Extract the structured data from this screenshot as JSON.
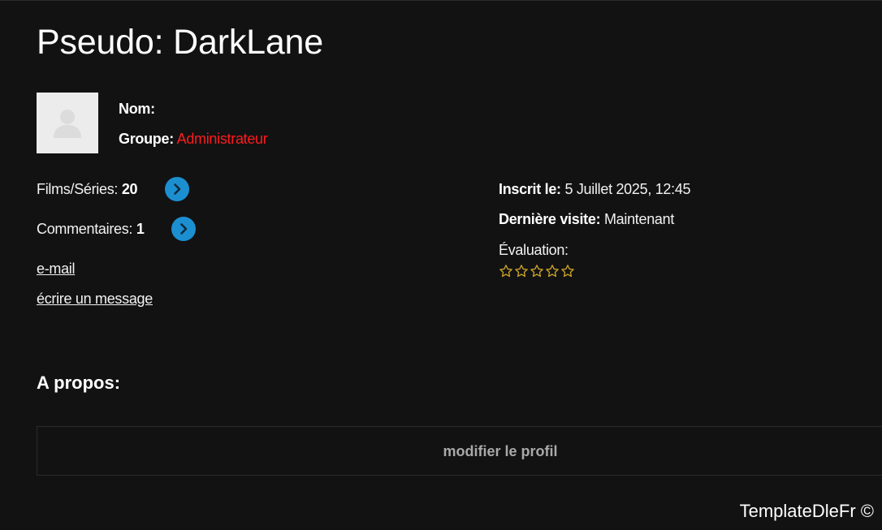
{
  "profile": {
    "title": "Pseudo: DarkLane",
    "nom_label": "Nom:",
    "groupe_label": "Groupe:",
    "groupe_value": "Administrateur"
  },
  "stats": {
    "films_label": "Films/Séries:",
    "films_count": "20",
    "comments_label": "Commentaires:",
    "comments_count": "1"
  },
  "links": {
    "email": "e-mail",
    "message": "écrire un message"
  },
  "details": {
    "inscrit_label": "Inscrit le:",
    "inscrit_value": "5 Juillet 2025, 12:45",
    "visite_label": "Dernière visite:",
    "visite_value": "Maintenant",
    "evaluation_label": "Évaluation:",
    "rating": 0,
    "rating_max": 5,
    "star_color": "#c9a227"
  },
  "about": {
    "title": "A propos:"
  },
  "actions": {
    "edit_profile": "modifier le profil"
  },
  "footer": {
    "copyright": "TemplateDleFr ©"
  },
  "colors": {
    "background": "#121213",
    "accent_blue": "#1c8fd1",
    "group_red": "#ff1b1b"
  }
}
